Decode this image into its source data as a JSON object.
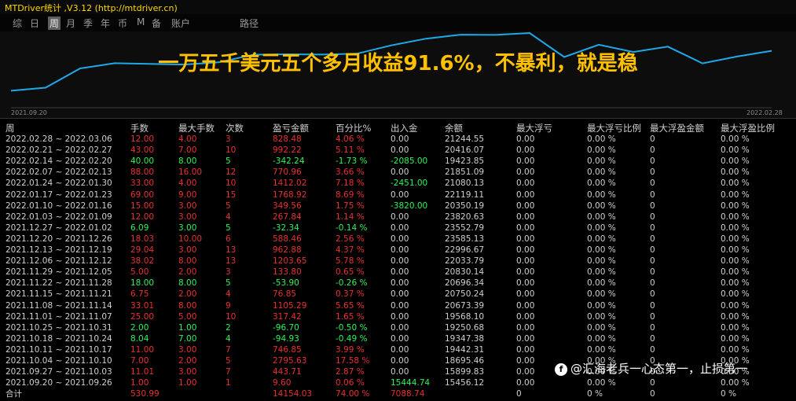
{
  "window_title": "MTDriver统计 ,V3.12 (http://mtdriver.cn)",
  "tabs": [
    {
      "label": "综"
    },
    {
      "label": "日"
    },
    {
      "label": "周",
      "active": true
    },
    {
      "label": "月"
    },
    {
      "label": "季"
    },
    {
      "label": "年"
    },
    {
      "label": "币"
    },
    {
      "label": "M"
    },
    {
      "label": "备"
    },
    {
      "label": "账户"
    },
    {
      "label": "路径"
    }
  ],
  "chart": {
    "start_date": "2021.09.20",
    "end_date": "2022.02.28",
    "line_color": "#1fa8e8",
    "balance_series": [
      15456.12,
      15899.83,
      18695.46,
      19442.31,
      19347.38,
      19250.68,
      19568.1,
      20673.39,
      20750.24,
      20696.34,
      20830.14,
      22033.79,
      22996.67,
      23585.13,
      23552.79,
      23820.63,
      20350.19,
      22119.11,
      21080.13,
      21851.09,
      19423.85,
      20416.07,
      21244.55
    ]
  },
  "headline": "一万五千美元五个多月收益91.6%，不暴利，就是稳",
  "colors": {
    "positive": "#e83030",
    "negative": "#2ff25a",
    "headline": "#ffc000"
  },
  "table": {
    "headers": [
      "周",
      "手数",
      "最大手数",
      "次数",
      "盈亏金额",
      "百分比%",
      "出入金",
      "余额",
      "最大浮亏",
      "最大浮亏比例",
      "最大浮盈金额",
      "最大浮盈比例"
    ],
    "rows": [
      {
        "sign": "pos",
        "cells": [
          "2022.02.28 ~ 2022.03.06",
          "12.00",
          "4.00",
          "3",
          "828.48",
          "4.06 %",
          "0.00",
          "21244.55",
          "0.00",
          "0.00 %",
          "0",
          "0.00 %"
        ]
      },
      {
        "sign": "pos",
        "cells": [
          "2022.02.21 ~ 2022.02.27",
          "43.00",
          "7.00",
          "10",
          "992.22",
          "5.11 %",
          "0.00",
          "20416.07",
          "0.00",
          "0.00 %",
          "0",
          "0.00 %"
        ]
      },
      {
        "sign": "neg",
        "cells": [
          "2022.02.14 ~ 2022.02.20",
          "40.00",
          "8.00",
          "5",
          "-342.24",
          "-1.73 %",
          "-2085.00",
          "19423.85",
          "0.00",
          "0.00 %",
          "0",
          "0.00 %"
        ]
      },
      {
        "sign": "pos",
        "cells": [
          "2022.02.07 ~ 2022.02.13",
          "88.00",
          "16.00",
          "12",
          "770.96",
          "3.66 %",
          "0.00",
          "21851.09",
          "0.00",
          "0.00 %",
          "0",
          "0.00 %"
        ]
      },
      {
        "sign": "pos",
        "cells": [
          "2022.01.24 ~ 2022.01.30",
          "33.00",
          "4.00",
          "10",
          "1412.02",
          "7.18 %",
          "-2451.00",
          "21080.13",
          "0.00",
          "0.00 %",
          "0",
          "0.00 %"
        ]
      },
      {
        "sign": "pos",
        "cells": [
          "2022.01.17 ~ 2022.01.23",
          "69.00",
          "9.00",
          "15",
          "1768.92",
          "8.69 %",
          "0.00",
          "22119.11",
          "0.00",
          "0.00 %",
          "0",
          "0.00 %"
        ]
      },
      {
        "sign": "pos",
        "cells": [
          "2022.01.10 ~ 2022.01.16",
          "15.00",
          "3.00",
          "5",
          "349.56",
          "1.75 %",
          "-3820.00",
          "20350.19",
          "0.00",
          "0.00 %",
          "0",
          "0.00 %"
        ]
      },
      {
        "sign": "pos",
        "cells": [
          "2022.01.03 ~ 2022.01.09",
          "12.00",
          "3.00",
          "4",
          "267.84",
          "1.14 %",
          "0.00",
          "23820.63",
          "0.00",
          "0.00 %",
          "0",
          "0.00 %"
        ]
      },
      {
        "sign": "neg",
        "cells": [
          "2021.12.27 ~ 2022.01.02",
          "6.09",
          "3.00",
          "5",
          "-32.34",
          "-0.14 %",
          "0.00",
          "23552.79",
          "0.00",
          "0.00 %",
          "0",
          "0.00 %"
        ]
      },
      {
        "sign": "pos",
        "cells": [
          "2021.12.20 ~ 2021.12.26",
          "18.03",
          "10.00",
          "6",
          "588.46",
          "2.56 %",
          "0.00",
          "23585.13",
          "0.00",
          "0.00 %",
          "0",
          "0.00 %"
        ]
      },
      {
        "sign": "pos",
        "cells": [
          "2021.12.13 ~ 2021.12.19",
          "29.04",
          "3.00",
          "13",
          "962.88",
          "4.37 %",
          "0.00",
          "22996.67",
          "0.00",
          "0.00 %",
          "0",
          "0.00 %"
        ]
      },
      {
        "sign": "pos",
        "cells": [
          "2021.12.06 ~ 2021.12.12",
          "38.02",
          "8.00",
          "13",
          "1203.65",
          "5.78 %",
          "0.00",
          "22033.79",
          "0.00",
          "0.00 %",
          "0",
          "0.00 %"
        ]
      },
      {
        "sign": "pos",
        "cells": [
          "2021.11.29 ~ 2021.12.05",
          "5.00",
          "2.00",
          "3",
          "133.80",
          "0.65 %",
          "0.00",
          "20830.14",
          "0.00",
          "0.00 %",
          "0",
          "0.00 %"
        ]
      },
      {
        "sign": "neg",
        "cells": [
          "2021.11.22 ~ 2021.11.28",
          "18.00",
          "8.00",
          "5",
          "-53.90",
          "-0.26 %",
          "0.00",
          "20696.34",
          "0.00",
          "0.00 %",
          "0",
          "0.00 %"
        ]
      },
      {
        "sign": "pos",
        "cells": [
          "2021.11.15 ~ 2021.11.21",
          "6.75",
          "2.00",
          "4",
          "76.85",
          "0.37 %",
          "0.00",
          "20750.24",
          "0.00",
          "0.00 %",
          "0",
          "0.00 %"
        ]
      },
      {
        "sign": "pos",
        "cells": [
          "2021.11.08 ~ 2021.11.14",
          "33.01",
          "8.00",
          "9",
          "1105.29",
          "5.65 %",
          "0.00",
          "20673.39",
          "0.00",
          "0.00 %",
          "0",
          "0.00 %"
        ]
      },
      {
        "sign": "pos",
        "cells": [
          "2021.11.01 ~ 2021.11.07",
          "25.00",
          "5.00",
          "10",
          "317.42",
          "1.65 %",
          "0.00",
          "19568.10",
          "0.00",
          "0.00 %",
          "0",
          "0.00 %"
        ]
      },
      {
        "sign": "neg",
        "cells": [
          "2021.10.25 ~ 2021.10.31",
          "2.00",
          "1.00",
          "2",
          "-96.70",
          "-0.50 %",
          "0.00",
          "19250.68",
          "0.00",
          "0.00 %",
          "0",
          "0.00 %"
        ]
      },
      {
        "sign": "neg",
        "cells": [
          "2021.10.18 ~ 2021.10.24",
          "8.04",
          "7.00",
          "4",
          "-94.93",
          "-0.49 %",
          "0.00",
          "19347.38",
          "0.00",
          "0.00 %",
          "0",
          "0.00 %"
        ]
      },
      {
        "sign": "pos",
        "cells": [
          "2021.10.11 ~ 2021.10.17",
          "11.00",
          "3.00",
          "7",
          "746.85",
          "3.99 %",
          "0.00",
          "19442.31",
          "0.00",
          "0.00 %",
          "0",
          "0.00 %"
        ]
      },
      {
        "sign": "pos",
        "cells": [
          "2021.10.04 ~ 2021.10.10",
          "7.00",
          "2.00",
          "5",
          "2795.63",
          "17.58 %",
          "0.00",
          "18695.46",
          "0.00",
          "0.00 %",
          "0",
          "0.00 %"
        ]
      },
      {
        "sign": "pos",
        "cells": [
          "2021.09.27 ~ 2021.10.03",
          "11.01",
          "3.00",
          "7",
          "443.71",
          "2.87 %",
          "0.00",
          "15899.83",
          "0.00",
          "0.00 %",
          "0",
          "0.00 %"
        ]
      },
      {
        "sign": "pos",
        "cells": [
          "2021.09.20 ~ 2021.09.26",
          "1.00",
          "1.00",
          "1",
          "9.60",
          "0.06 %",
          "15444.74",
          "15456.12",
          "0.00",
          "0.00 %",
          "0",
          "0.00 %"
        ]
      }
    ],
    "total": {
      "label": "合计",
      "cells": [
        "530.99",
        "",
        "",
        "14154.03",
        "74.00 %",
        "7088.74",
        "",
        "0",
        "0 %",
        "0",
        "0 %"
      ]
    }
  },
  "watermark": {
    "icon": "f",
    "text": "@汇海老兵一心态第一，止损第一"
  }
}
